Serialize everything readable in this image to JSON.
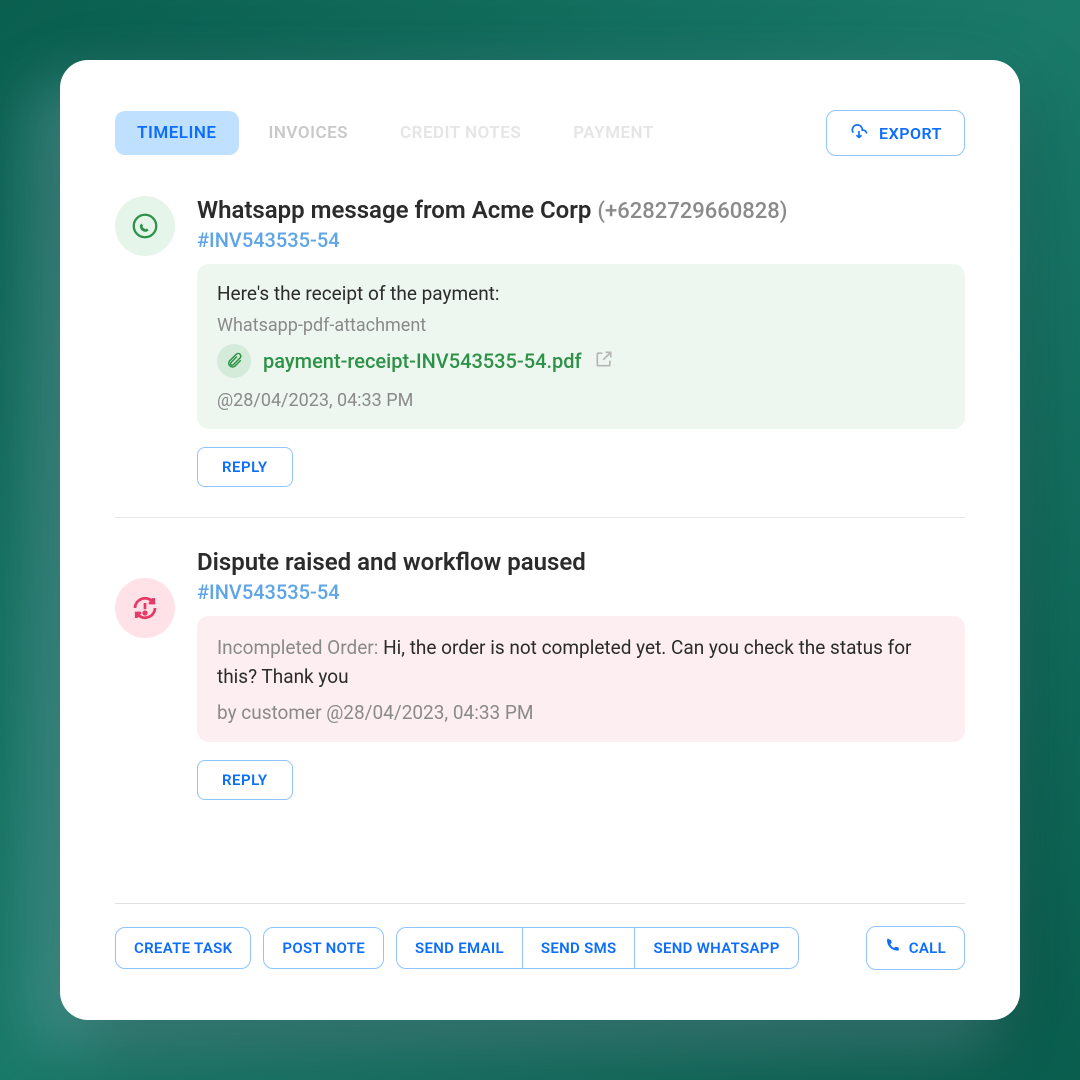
{
  "tabs": {
    "timeline": "TIMELINE",
    "invoices": "INVOICES",
    "credit_notes": "CREDIT NOTES",
    "payment": "PAYMENT"
  },
  "export_label": "EXPORT",
  "entry1": {
    "title": "Whatsapp message from Acme Corp",
    "phone": "(+6282729660828)",
    "invoice": "#INV543535-54",
    "message": "Here's the receipt of the payment:",
    "attachment_label": "Whatsapp-pdf-attachment",
    "attachment_name": "payment-receipt-INV543535-54.pdf",
    "timestamp": "@28/04/2023, 04:33 PM",
    "reply": "REPLY"
  },
  "entry2": {
    "title": "Dispute raised and workflow paused",
    "invoice": "#INV543535-54",
    "label": "Incompleted Order: ",
    "text": "Hi, the order is not completed yet. Can you check the status for this? Thank you",
    "byline": "by customer @28/04/2023, 04:33 PM",
    "reply": "REPLY"
  },
  "actions": {
    "create_task": "CREATE TASK",
    "post_note": "POST NOTE",
    "send_email": "SEND EMAIL",
    "send_sms": "SEND SMS",
    "send_whatsapp": "SEND WHATSAPP",
    "call": "CALL"
  }
}
